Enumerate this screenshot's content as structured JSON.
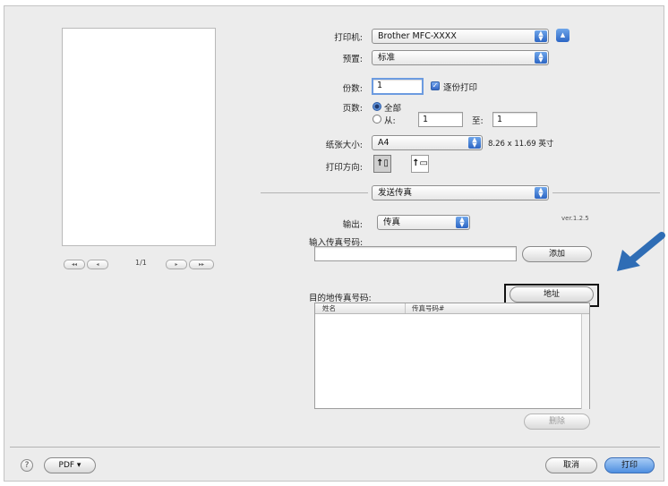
{
  "printer": {
    "label": "打印机:",
    "value": "Brother MFC-XXXX",
    "expand_icon": "disclosure-triangle-icon"
  },
  "presets": {
    "label": "预置:",
    "value": "标准"
  },
  "copies": {
    "label": "份数:",
    "value": "1",
    "collated_label": "逐份打印",
    "collated": true
  },
  "pages": {
    "label": "页数:",
    "all_label": "全部",
    "from_label": "从:",
    "from_value": "1",
    "to_label": "至:",
    "to_value": "1",
    "selected": "all"
  },
  "paper_size": {
    "label": "纸张大小:",
    "value": "A4",
    "dimensions": "8.26 x 11.69 英寸"
  },
  "orientation": {
    "label": "打印方向:",
    "portrait_icon": "portrait-orientation-icon",
    "landscape_icon": "landscape-orientation-icon",
    "selected": "portrait"
  },
  "preview": {
    "page_indicator": "1/1",
    "first_label": "◂◂",
    "prev_label": "◂",
    "next_label": "▸",
    "last_label": "▸▸"
  },
  "panel_menu": {
    "value": "发送传真"
  },
  "output": {
    "label": "输出:",
    "value": "传真",
    "version": "ver.1.2.5"
  },
  "fax_input": {
    "label": "输入传真号码:",
    "value": "",
    "add_button": "添加"
  },
  "destination": {
    "label": "目的地传真号码:",
    "address_button": "地址",
    "columns": [
      "姓名",
      "传真号码#"
    ],
    "rows": [],
    "delete_button": "删除"
  },
  "footer": {
    "help_label": "?",
    "pdf_label": "PDF ▾",
    "cancel_label": "取消",
    "print_label": "打印"
  },
  "colors": {
    "accent": "#3a72c9",
    "arrow": "#2f6db5"
  }
}
